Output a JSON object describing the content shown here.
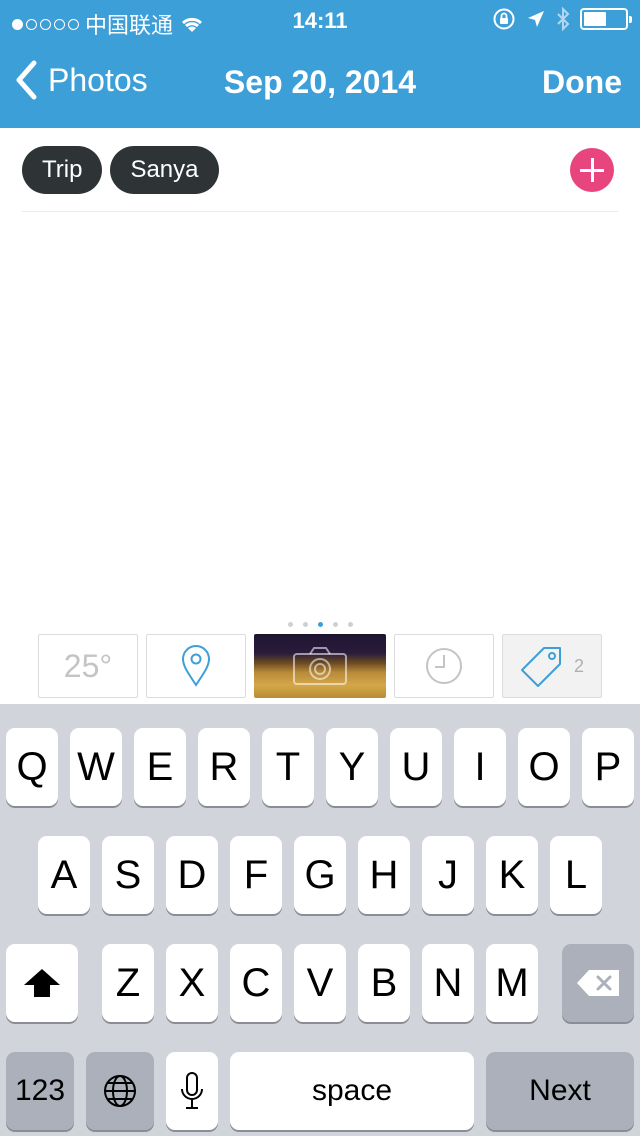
{
  "status_bar": {
    "carrier": "中国联通",
    "time": "14:11"
  },
  "nav": {
    "back_label": "Photos",
    "title": "Sep 20, 2014",
    "done_label": "Done"
  },
  "tags": [
    "Trip",
    "Sanya"
  ],
  "toolbar": {
    "temperature": "25°",
    "tag_count": "2",
    "page_count": 5,
    "active_page": 2
  },
  "keyboard": {
    "row1": [
      "Q",
      "W",
      "E",
      "R",
      "T",
      "Y",
      "U",
      "I",
      "O",
      "P"
    ],
    "row2": [
      "A",
      "S",
      "D",
      "F",
      "G",
      "H",
      "J",
      "K",
      "L"
    ],
    "row3": [
      "Z",
      "X",
      "C",
      "V",
      "B",
      "N",
      "M"
    ],
    "numbers_label": "123",
    "space_label": "space",
    "return_label": "Next"
  },
  "colors": {
    "nav_background": "#3d9fd8",
    "tag_background": "#2e3436",
    "add_button": "#e8457f",
    "keyboard_background": "#d1d5db"
  }
}
